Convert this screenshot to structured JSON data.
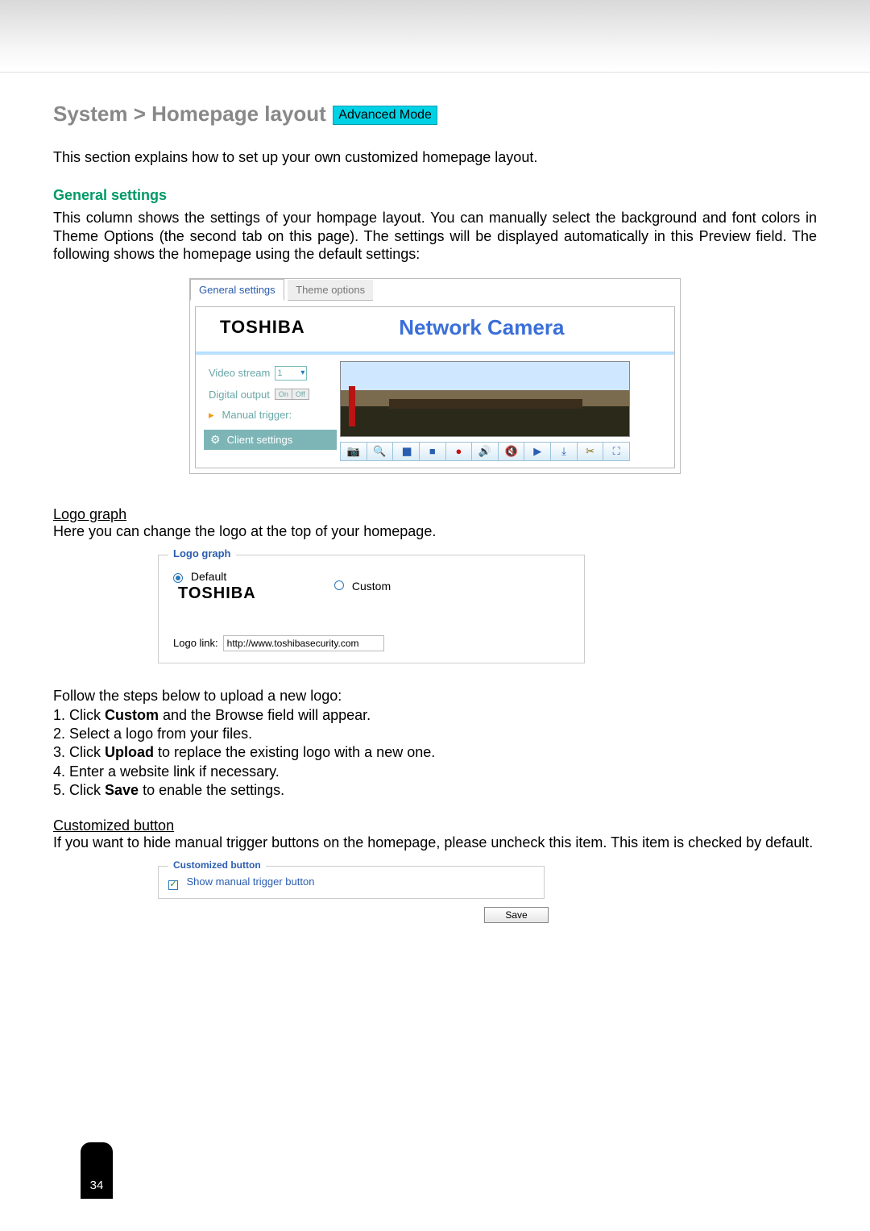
{
  "page": {
    "title_prefix": "System > Homepage layout",
    "badge": "Advanced Mode",
    "intro": "This section explains how to set up your own customized homepage layout.",
    "page_number": "34"
  },
  "general": {
    "heading": "General settings",
    "paragraph": "This column shows the settings of your hompage layout. You can manually select the background and font colors in Theme Options (the second tab on this page). The settings will be displayed automatically in this Preview field. The following shows the homepage using the default settings:"
  },
  "tabs": {
    "general": "General settings",
    "theme": "Theme options"
  },
  "preview": {
    "brand": "TOSHIBA",
    "product": "Network Camera",
    "sidebar": {
      "video_stream_label": "Video stream",
      "video_stream_value": "1",
      "digital_output_label": "Digital output",
      "digital_output_on": "On",
      "digital_output_off": "Off",
      "manual_trigger_label": "Manual trigger:",
      "client_settings": "Client settings"
    },
    "toolbar_icons": [
      "camera",
      "zoom",
      "pause",
      "stop",
      "record",
      "volume-up",
      "mute",
      "play",
      "download",
      "scissors",
      "fullscreen"
    ]
  },
  "logo": {
    "section_title": "Logo graph",
    "section_text": "Here you can change the logo at the top of your homepage.",
    "legend": "Logo graph",
    "default_label": "Default",
    "custom_label": "Custom",
    "brand": "TOSHIBA",
    "link_label": "Logo link:",
    "link_value": "http://www.toshibasecurity.com"
  },
  "steps": {
    "intro": "Follow the steps below to upload a new logo:",
    "items": [
      {
        "n": "1. Click ",
        "b": "Custom",
        "t": " and the Browse field will appear."
      },
      {
        "n": "2. Select a logo from your files.",
        "b": "",
        "t": ""
      },
      {
        "n": "3. Click ",
        "b": "Upload",
        "t": " to replace the existing logo with a new one."
      },
      {
        "n": "4. Enter a website link if necessary.",
        "b": "",
        "t": ""
      },
      {
        "n": "5. Click ",
        "b": "Save",
        "t": " to enable the settings."
      }
    ]
  },
  "custbtn": {
    "section_title": "Customized button",
    "section_text": "If you want to hide manual trigger buttons on the homepage, please uncheck this item. This item is checked by default.",
    "legend": "Customized button",
    "checkbox_label": "Show manual trigger button",
    "save": "Save"
  }
}
